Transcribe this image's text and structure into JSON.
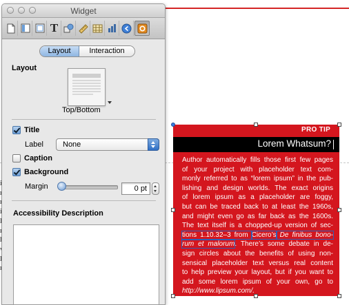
{
  "window": {
    "title": "Widget"
  },
  "toolbar": {
    "tools": [
      {
        "icon": "document-icon"
      },
      {
        "icon": "layout-icon"
      },
      {
        "icon": "page-icon"
      },
      {
        "icon": "text-icon",
        "glyph": "T"
      },
      {
        "icon": "shapes-icon"
      },
      {
        "icon": "ruler-icon"
      },
      {
        "icon": "table-icon"
      },
      {
        "icon": "chart-icon"
      },
      {
        "icon": "link-icon"
      },
      {
        "icon": "widget-gear-icon"
      }
    ]
  },
  "tabs": {
    "layout": "Layout",
    "interaction": "Interaction"
  },
  "layout_section": {
    "heading": "Layout",
    "thumb_caption": "Top/Bottom"
  },
  "title_option": {
    "label": "Title",
    "checked": true,
    "sub_label": "Label",
    "label_value": "None"
  },
  "caption_option": {
    "label": "Caption",
    "checked": false
  },
  "background_option": {
    "label": "Background",
    "checked": true,
    "margin_label": "Margin",
    "margin_value": "0 pt"
  },
  "accessibility": {
    "heading": "Accessibility Description",
    "value": ""
  },
  "document": {
    "left_text": [
      "ir",
      "nd",
      "me",
      "ir",
      "lo",
      "ne",
      "ho",
      "wi",
      "lo",
      "ne"
    ]
  },
  "widget": {
    "header": "PRO TIP",
    "title": "Lorem Whatsum?",
    "body_lines": [
      "Author automatically fills those first few pages",
      "of your project with placeholder text com-",
      "monly referred to as “lorem ipsum” in the pub-",
      "lishing and design worlds. The exact origins",
      "of lorem ipsum as a placeholder are foggy,",
      "but can be traced back to at least the 1960s,",
      "and might even go as far back as the 1600s.",
      "The text itself is a chopped-up version of sec-"
    ],
    "line9_a": "tions 1.10.32–3 from ",
    "line9_b": "Cicero’s",
    "line9_c": " De finibus bono-",
    "line10_a": "rum et malorum",
    "line10_b": ". There’s some debate in de-",
    "body_lines_end": [
      "sign circles about the benefits of using non-",
      "sensical placeholder text versus real content",
      "to help preview your layout, but if you want to",
      "add some lorem ipsum of your own, go to"
    ],
    "url": "http://www.lipsum.com/."
  },
  "colors": {
    "widget_red": "#d4161e",
    "accent_blue": "#3b7de0",
    "rule_red": "#d42424"
  }
}
